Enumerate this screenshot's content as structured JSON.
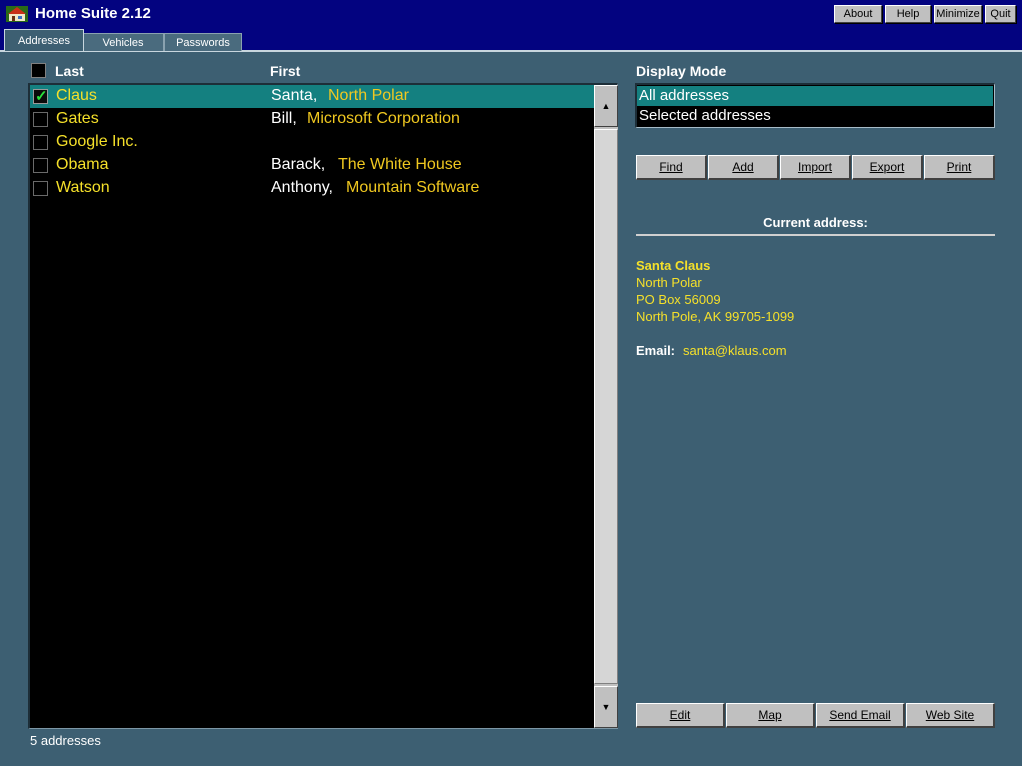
{
  "window": {
    "title": "Home Suite 2.12"
  },
  "titlebar_buttons": {
    "about": "About",
    "help": "Help",
    "minimize": "Minimize",
    "quit": "Quit"
  },
  "tabs": [
    {
      "label": "Addresses",
      "active": true
    },
    {
      "label": "Vehicles",
      "active": false
    },
    {
      "label": "Passwords",
      "active": false
    }
  ],
  "list": {
    "columns": {
      "last": "Last",
      "first": "First"
    },
    "rows": [
      {
        "last": "Claus",
        "first": "Santa,",
        "company": "North Polar",
        "checked": true,
        "selected": true
      },
      {
        "last": "Gates",
        "first": "Bill,",
        "company": "Microsoft Corporation",
        "checked": false,
        "selected": false
      },
      {
        "last": "Google Inc.",
        "first": "",
        "company": "",
        "checked": false,
        "selected": false
      },
      {
        "last": "Obama",
        "first": "Barack,",
        "company": "The White House",
        "checked": false,
        "selected": false
      },
      {
        "last": "Watson",
        "first": "Anthony,",
        "company": "Mountain Software",
        "checked": false,
        "selected": false
      }
    ],
    "status": "5 addresses"
  },
  "display_mode": {
    "title": "Display Mode",
    "options": [
      "All addresses",
      "Selected addresses"
    ],
    "selected": "All addresses"
  },
  "actions": {
    "find": "Find",
    "add": "Add",
    "import": "Import",
    "export": "Export",
    "print": "Print"
  },
  "current": {
    "title": "Current address:",
    "name": "Santa Claus",
    "line1": "North Polar",
    "line2": "PO Box 56009",
    "line3": "North Pole, AK  99705-1099",
    "email_label": "Email:",
    "email": "santa@klaus.com"
  },
  "bottom_actions": {
    "edit": "Edit",
    "map": "Map",
    "send_email": "Send Email",
    "web_site": "Web Site"
  },
  "colors": {
    "background": "#3d5f72",
    "titlebar": "#030380",
    "selection": "#148080",
    "text_yellow": "#f5e02a"
  }
}
